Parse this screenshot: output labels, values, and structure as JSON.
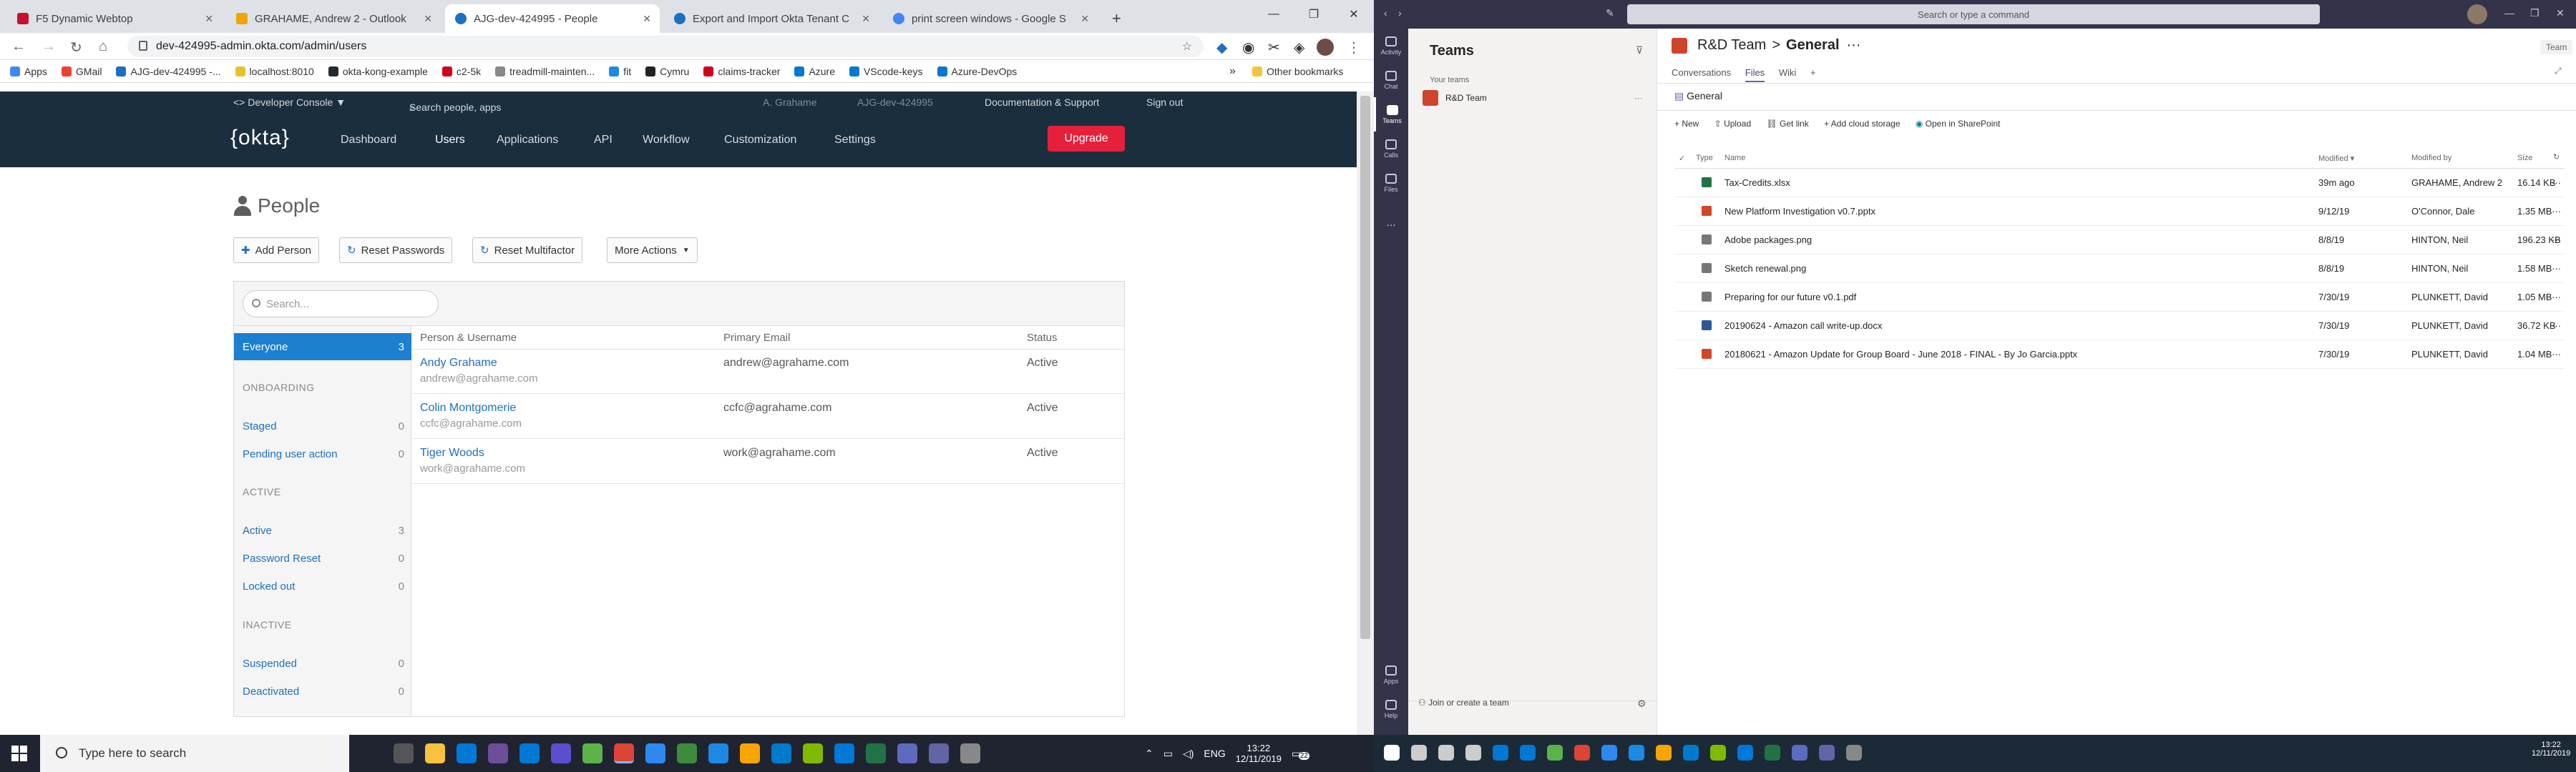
{
  "left": {
    "tabs": [
      {
        "title": "F5 Dynamic Webtop",
        "fav": "#c8102e"
      },
      {
        "title": "GRAHAME, Andrew 2 - Outlook",
        "fav": "#f0a30a"
      },
      {
        "title": "AJG-dev-424995 - People",
        "fav": "#1d6fc0"
      },
      {
        "title": "Export and Import Okta Tenant C",
        "fav": "#1d6fc0"
      },
      {
        "title": "print screen windows - Google S",
        "fav": "#4285f4"
      }
    ],
    "url": "dev-424995-admin.okta.com/admin/users",
    "bookmarks": [
      {
        "label": "Apps",
        "color": "#4285f4"
      },
      {
        "label": "GMail",
        "color": "#ea4335"
      },
      {
        "label": "AJG-dev-424995 -...",
        "color": "#1d6fc0"
      },
      {
        "label": "localhost:8010",
        "color": "#e8c12e"
      },
      {
        "label": "okta-kong-example",
        "color": "#24292e"
      },
      {
        "label": "c2-5k",
        "color": "#d0021b"
      },
      {
        "label": "treadmill-mainten...",
        "color": "#888888"
      },
      {
        "label": "fit",
        "color": "#1e88e5"
      },
      {
        "label": "Cymru",
        "color": "#222222"
      },
      {
        "label": "claims-tracker",
        "color": "#d0021b"
      },
      {
        "label": "Azure",
        "color": "#0078d4"
      },
      {
        "label": "VScode-keys",
        "color": "#007acc"
      },
      {
        "label": "Azure-DevOps",
        "color": "#0078d4"
      }
    ],
    "other_bookmarks": "Other bookmarks",
    "okta": {
      "dev_console": "<> Developer Console ▼",
      "search_placeholder": "Search people, apps",
      "user": "A. Grahame",
      "org": "AJG-dev-424995",
      "doc_support": "Documentation & Support",
      "sign_out": "Sign out",
      "logo": "{okta}",
      "menu": [
        "Dashboard",
        "Users",
        "Applications",
        "API",
        "Workflow",
        "Customization",
        "Settings"
      ],
      "upgrade": "Upgrade",
      "page_title": "People",
      "buttons": [
        "Add Person",
        "Reset Passwords",
        "Reset Multifactor",
        "More Actions"
      ],
      "search": "Search...",
      "sidebar": {
        "everyone": {
          "label": "Everyone",
          "count": "3"
        },
        "onboarding": "ONBOARDING",
        "staged": {
          "label": "Staged",
          "count": "0"
        },
        "pending": {
          "label": "Pending user action",
          "count": "0"
        },
        "active_h": "ACTIVE",
        "active": {
          "label": "Active",
          "count": "3"
        },
        "pwreset": {
          "label": "Password Reset",
          "count": "0"
        },
        "locked": {
          "label": "Locked out",
          "count": "0"
        },
        "inactive_h": "INACTIVE",
        "suspended": {
          "label": "Suspended",
          "count": "0"
        },
        "deactivated": {
          "label": "Deactivated",
          "count": "0"
        }
      },
      "columns": [
        "Person & Username",
        "Primary Email",
        "Status"
      ],
      "rows": [
        {
          "name": "Andy Grahame",
          "username": "andrew@agrahame.com",
          "email": "andrew@agrahame.com",
          "status": "Active"
        },
        {
          "name": "Colin Montgomerie",
          "username": "ccfc@agrahame.com",
          "email": "ccfc@agrahame.com",
          "status": "Active"
        },
        {
          "name": "Tiger Woods",
          "username": "work@agrahame.com",
          "email": "work@agrahame.com",
          "status": "Active"
        }
      ]
    },
    "taskbar": {
      "search": "Type here to search",
      "lang": "ENG",
      "time": "13:22",
      "date": "12/11/2019",
      "badge": "22"
    }
  },
  "right": {
    "command": "Search or type a command",
    "team_tag": "Team",
    "rail": [
      "Activity",
      "Chat",
      "Teams",
      "Calls",
      "Files",
      "...",
      "Apps",
      "Help"
    ],
    "teams_title": "Teams",
    "your_teams": "Your teams",
    "team_name": "R&D Team",
    "join": "Join or create a team",
    "breadcrumb_team": "R&D Team",
    "breadcrumb_sep": ">",
    "breadcrumb_channel": "General",
    "more": "···",
    "channel_tabs": [
      "Conversations",
      "Files",
      "Wiki",
      "+"
    ],
    "folder": "General",
    "toolbar": [
      "New",
      "Upload",
      "Get link",
      "Add cloud storage",
      "Open in SharePoint"
    ],
    "columns": [
      "Type",
      "Name",
      "Modified ▾",
      "Modified by",
      "Size"
    ],
    "files": [
      {
        "name": "Tax-Credits.xlsx",
        "modified": "39m ago",
        "by": "GRAHAME, Andrew 2",
        "size": "16.14 KB",
        "color": "#217346"
      },
      {
        "name": "New Platform Investigation v0.7.pptx",
        "modified": "9/12/19",
        "by": "O'Connor, Dale",
        "size": "1.35 MB",
        "color": "#d24726"
      },
      {
        "name": "Adobe packages.png",
        "modified": "8/8/19",
        "by": "HINTON, Neil",
        "size": "196.23 KB",
        "color": "#777777"
      },
      {
        "name": "Sketch renewal.png",
        "modified": "8/8/19",
        "by": "HINTON, Neil",
        "size": "1.58 MB",
        "color": "#777777"
      },
      {
        "name": "Preparing for our future v0.1.pdf",
        "modified": "7/30/19",
        "by": "PLUNKETT, David",
        "size": "1.05 MB",
        "color": "#777777"
      },
      {
        "name": "20190624 - Amazon call write-up.docx",
        "modified": "7/30/19",
        "by": "PLUNKETT, David",
        "size": "36.72 KB",
        "color": "#2b579a"
      },
      {
        "name": "20180621 - Amazon Update for Group Board - June 2018 - FINAL - By Jo Garcia.pptx",
        "modified": "7/30/19",
        "by": "PLUNKETT, David",
        "size": "1.04 MB",
        "color": "#d24726"
      }
    ],
    "taskbar": {
      "time": "13:22",
      "date": "12/11/2019"
    }
  }
}
